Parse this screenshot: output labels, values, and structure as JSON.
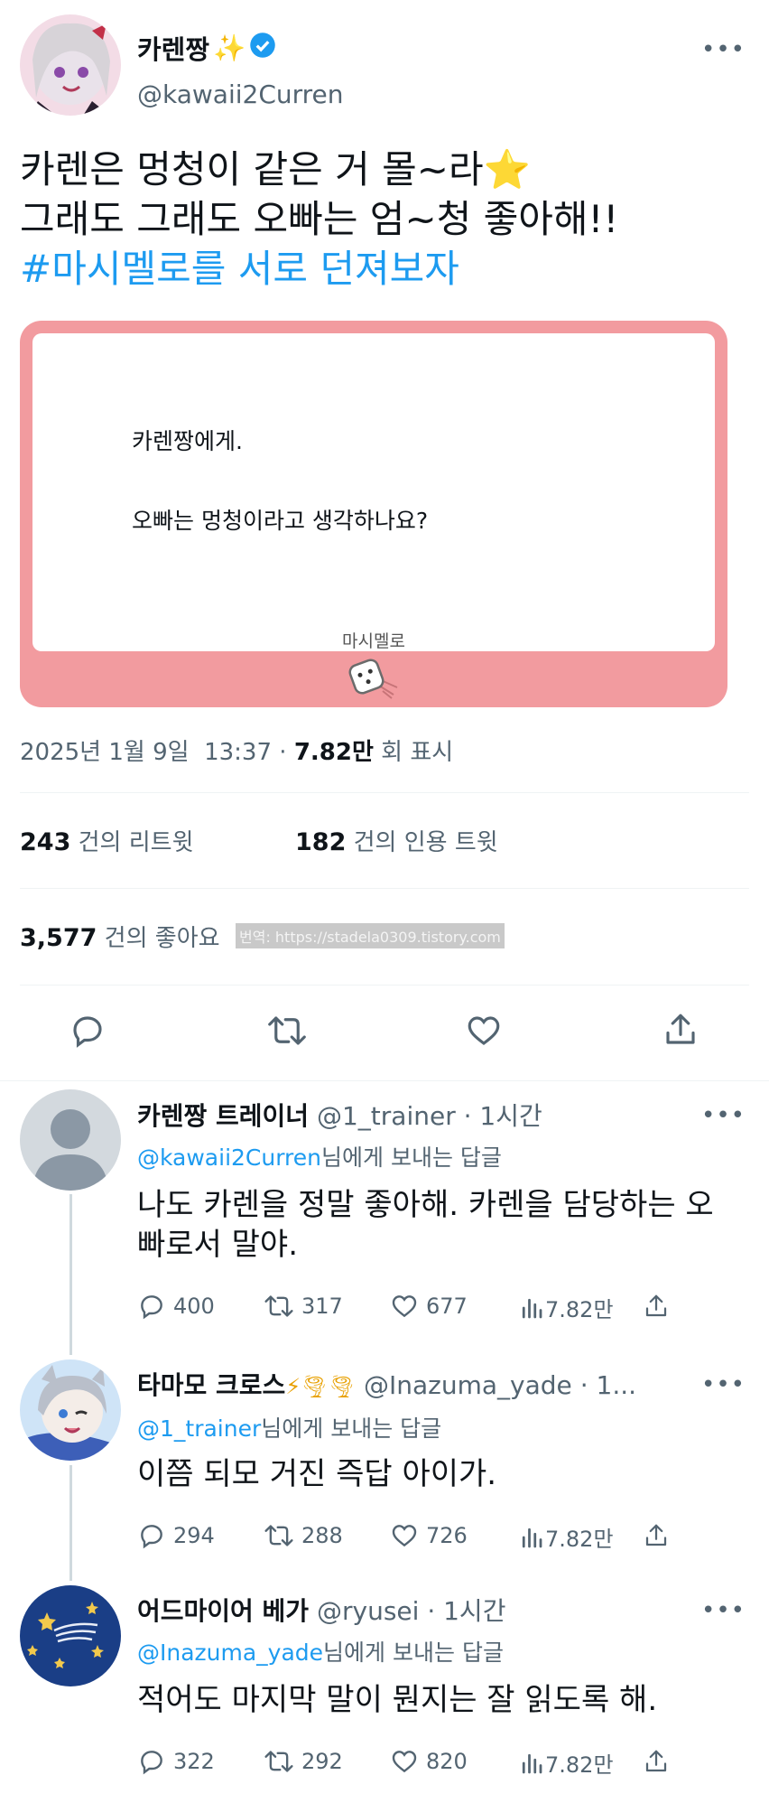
{
  "tweet": {
    "display_name": "카렌짱",
    "name_emoji": "✨",
    "handle": "@kawaii2Curren",
    "more": "•••",
    "text_line1": "카렌은 멍청이 같은 거 몰~라",
    "text_emoji1": "⭐",
    "text_line2": "그래도 그래도 오빠는 엄~청 좋아해!!",
    "hashtag": "#마시멜로를 서로 던져보자",
    "card": {
      "to": "카렌짱에게.",
      "question": "오빠는 멍청이라고 생각하나요?",
      "brand": "마시멜로"
    },
    "meta": {
      "date": "2025년 1월 9일",
      "time": "13:37",
      "sep": "·",
      "views": "7.82만",
      "views_suffix": "회 표시"
    },
    "stats": {
      "retweets": "243",
      "retweets_label": "건의 리트윗",
      "quotes": "182",
      "quotes_label": "건의 인용 트윗",
      "likes": "3,577",
      "likes_label": "건의 좋아요"
    },
    "watermark": "번역: https://stadela0309.tistory.com"
  },
  "replies": [
    {
      "name": "카렌짱 트레이너",
      "name_emoji": "",
      "handle": "@1_trainer",
      "time": "· 1시간",
      "to_handle": "@kawaii2Curren",
      "to_suffix": "님에게 보내는 답글",
      "text": "나도 카렌을 정말 좋아해. 카렌을 담당하는 오빠로서 말야.",
      "comments": "400",
      "retweets": "317",
      "likes": "677",
      "views": "7.82만"
    },
    {
      "name": "타마모 크로스",
      "name_emoji": "⚡🌪🌪",
      "handle": "@Inazuma_yade",
      "time": "· 1...",
      "to_handle": "@1_trainer",
      "to_suffix": "님에게 보내는 답글",
      "text": "이쯤 되모 거진 즉답 아이가.",
      "comments": "294",
      "retweets": "288",
      "likes": "726",
      "views": "7.82만"
    },
    {
      "name": "어드마이어 베가",
      "name_emoji": "",
      "handle": "@ryusei",
      "time": "· 1시간",
      "to_handle": "@Inazuma_yade",
      "to_suffix": "님에게 보내는 답글",
      "text": "적어도 마지막 말이 뭔지는 잘 읽도록 해.",
      "comments": "322",
      "retweets": "292",
      "likes": "820",
      "views": "7.82만"
    }
  ],
  "colors": {
    "accent": "#1d9bf0",
    "card_pink": "#f29b9f",
    "muted": "#536471"
  }
}
